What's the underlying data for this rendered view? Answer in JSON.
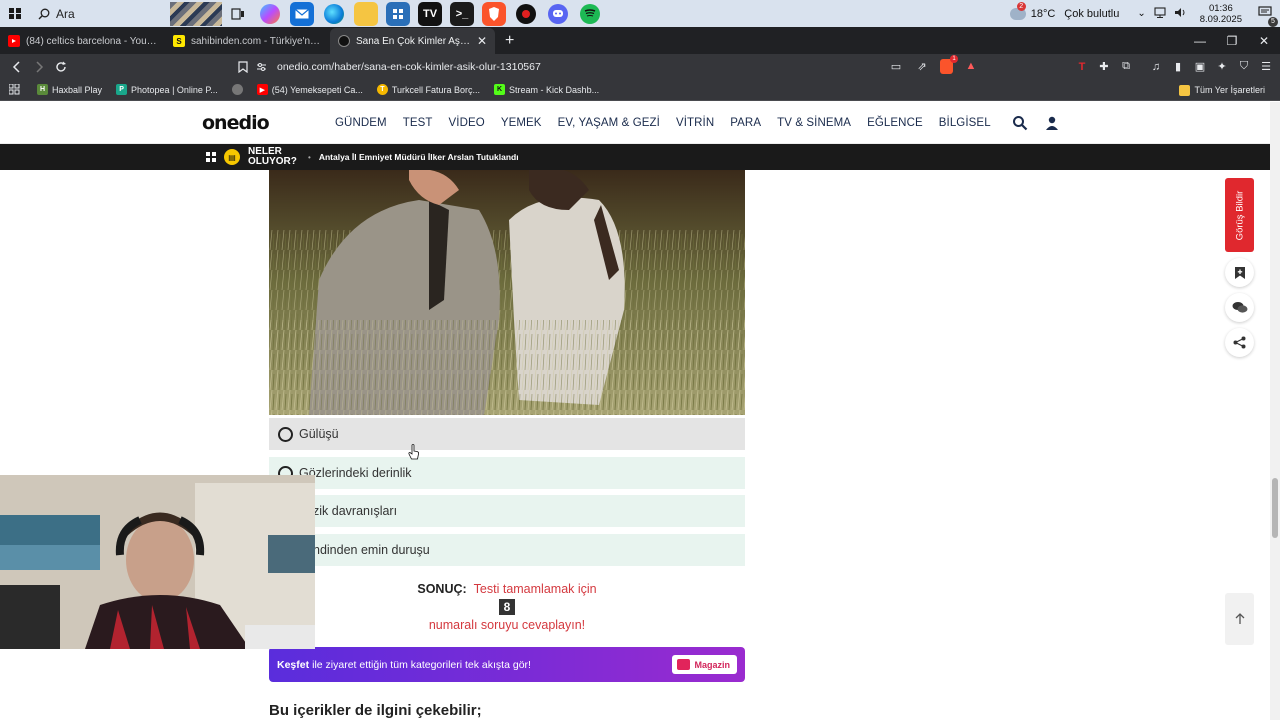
{
  "taskbar": {
    "search_label": "Ara",
    "weather_badge": "2",
    "weather": "18°C",
    "weather_desc": "Çok bulutlu",
    "time": "01:36",
    "date": "8.09.2025",
    "notification_count": "5"
  },
  "tabs": [
    {
      "title": "(84) celtics barcelona - YouTube",
      "favicon_color": "#ff0000"
    },
    {
      "title": "sahibinden.com - Türkiye'nin Online",
      "favicon_color": "#ffe800",
      "favicon_letter": "S"
    },
    {
      "title": "Sana En Çok Kimler Aşık Olur? -",
      "favicon_color": "#111111",
      "active": true
    }
  ],
  "address": {
    "url": "onedio.com/haber/sana-en-cok-kimler-asik-olur-1310567",
    "shield_badge": "1"
  },
  "bookmarks": [
    {
      "label": "Haxball Play",
      "color": "#5a8a3a",
      "letter": "H"
    },
    {
      "label": "Photopea | Online P...",
      "color": "#19a78b",
      "letter": "P"
    },
    {
      "label": "",
      "color": "#777777",
      "letter": ""
    },
    {
      "label": "(54) Yemeksepeti Ca...",
      "color": "#ff0000",
      "letter": "▶"
    },
    {
      "label": "Turkcell Fatura Borç...",
      "color": "#f5b800",
      "letter": "T"
    },
    {
      "label": "Stream - Kick Dashb...",
      "color": "#53fc18",
      "letter": "K"
    }
  ],
  "bookmarks_all": "Tüm Yer İşaretleri",
  "site": {
    "logo": "onedio",
    "nav": [
      "GÜNDEM",
      "TEST",
      "VİDEO",
      "YEMEK",
      "EV, YAŞAM & GEZİ",
      "VİTRİN",
      "PARA",
      "TV & SİNEMA",
      "EĞLENCE",
      "BİLGİSEL"
    ]
  },
  "ticker": {
    "label_line1": "NELER",
    "label_line2": "OLUYOR?",
    "headline": "Antalya İl Emniyet Müdürü İlker Arslan Tutuklandı"
  },
  "quiz": {
    "options": [
      {
        "label": "Gülüşü",
        "visible_text": "Gülüşü"
      },
      {
        "label": "Gözlerindeki derinlik",
        "visible_text": "Gözlerindeki derinlik"
      },
      {
        "label": "zik davranışları",
        "visible_text": "zik davranışları"
      },
      {
        "label": "ndinden emin duruşu",
        "visible_text": "ndinden emin duruşu"
      }
    ],
    "result_label": "SONUÇ:",
    "result_text1": "Testi tamamlamak için",
    "result_number": "8",
    "result_text2": "numaralı soruyu cevaplayın!"
  },
  "discover": {
    "bold": "Keşfet",
    "text": "ile ziyaret ettiğin tüm kategorileri tek akışta gör!",
    "button": "Magazin"
  },
  "more_title": "Bu içerikler de ilgini çekebilir;",
  "side": {
    "feedback": "Görüş Bildir"
  },
  "colors": {
    "accent_red": "#d4393f",
    "option_bg": "#e8f4ef",
    "discover_gradient_start": "#5a2ddc",
    "discover_gradient_end": "#9a2bcf",
    "feedback_red": "#e0282e"
  }
}
